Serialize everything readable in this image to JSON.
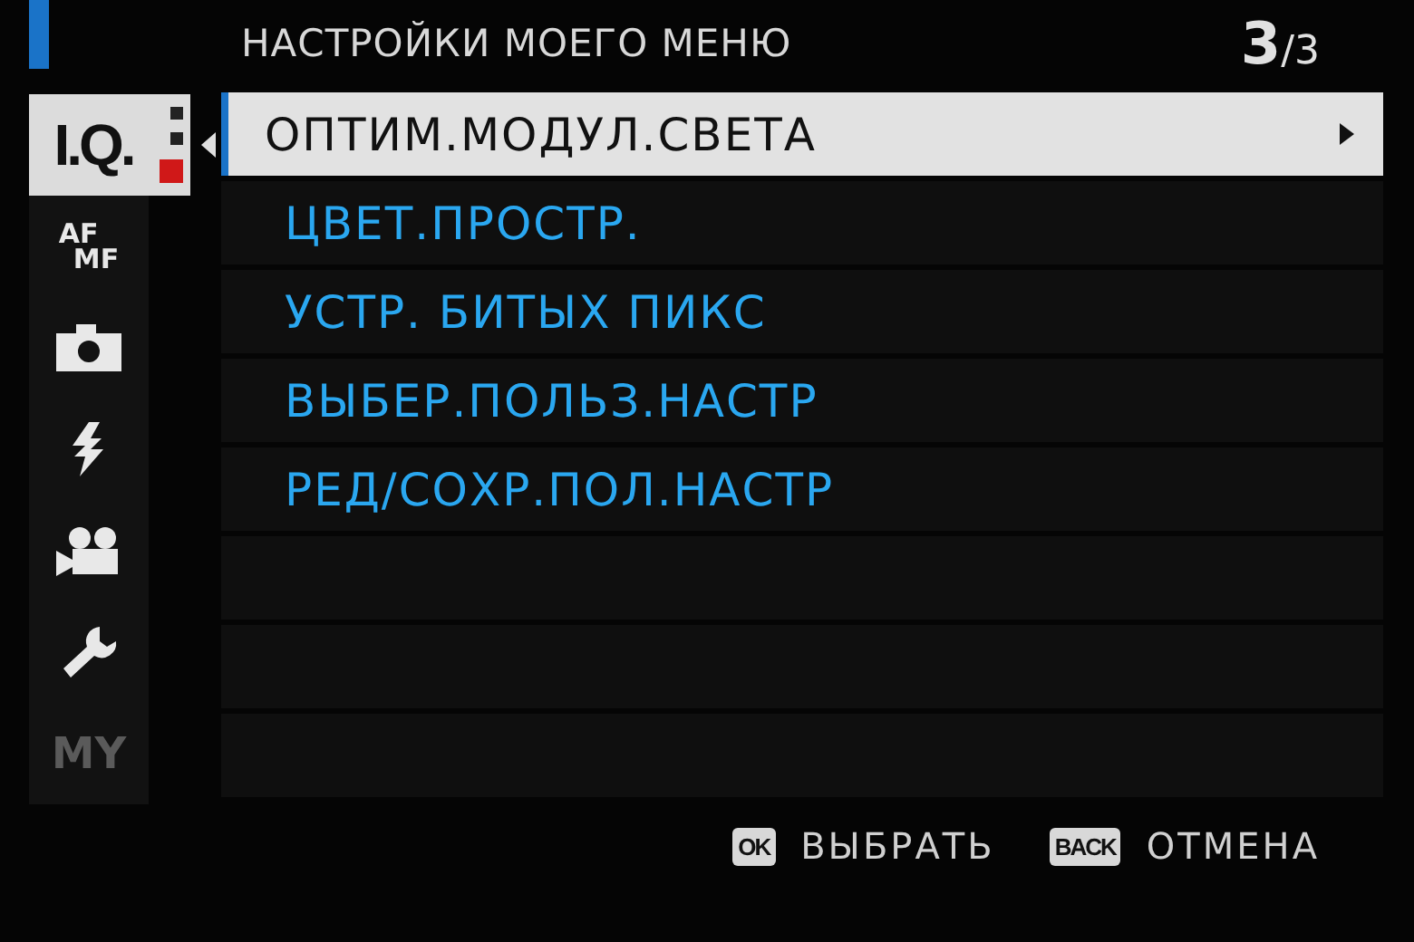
{
  "header": {
    "title": "НАСТРОЙКИ МОЕГО МЕНЮ",
    "page_current": "3",
    "page_total": "/3"
  },
  "tabs": [
    {
      "kind": "iq",
      "label": "I.Q.",
      "selected": true,
      "disabled": false
    },
    {
      "kind": "afmf",
      "label": "AF",
      "label2": "MF",
      "selected": false,
      "disabled": false
    },
    {
      "kind": "camera",
      "selected": false,
      "disabled": false
    },
    {
      "kind": "flash",
      "selected": false,
      "disabled": false
    },
    {
      "kind": "movie",
      "selected": false,
      "disabled": false
    },
    {
      "kind": "wrench",
      "selected": false,
      "disabled": false
    },
    {
      "kind": "my",
      "label": "MY",
      "selected": false,
      "disabled": true
    }
  ],
  "items": [
    {
      "label": "ОПТИМ.МОДУЛ.СВЕТА",
      "selected": true,
      "submenu": true
    },
    {
      "label": "ЦВЕТ.ПРОСТР.",
      "selected": false,
      "submenu": false
    },
    {
      "label": "УСТР. БИТЫХ ПИКС",
      "selected": false,
      "submenu": false
    },
    {
      "label": "ВЫБЕР.ПОЛЬЗ.НАСТР",
      "selected": false,
      "submenu": false
    },
    {
      "label": "РЕД/СОХР.ПОЛ.НАСТР",
      "selected": false,
      "submenu": false
    }
  ],
  "footer": [
    {
      "key": "OK",
      "label": "ВЫБРАТЬ"
    },
    {
      "key": "BACK",
      "label": "ОТМЕНА"
    }
  ]
}
